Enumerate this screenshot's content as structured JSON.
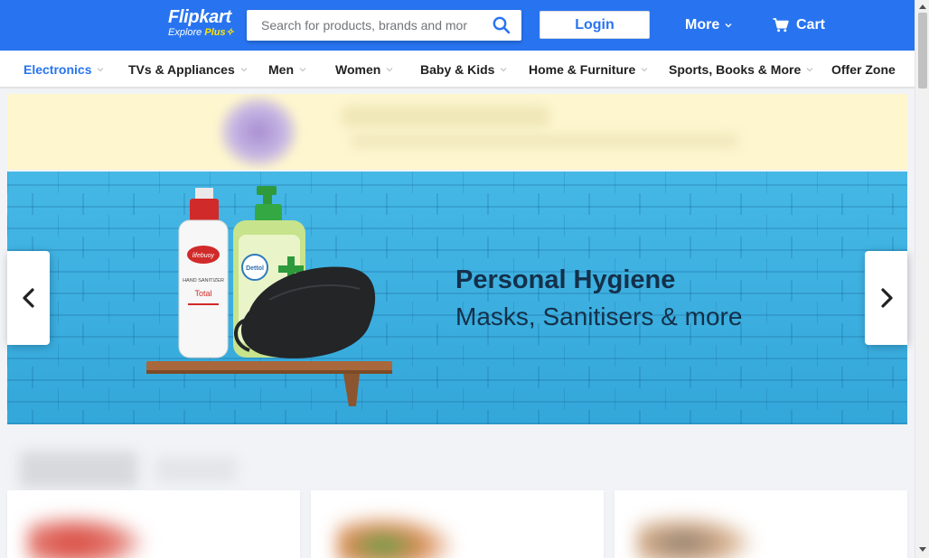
{
  "header": {
    "logo_text": "Flipkart",
    "logo_sub_explore": "Explore",
    "logo_sub_plus": "Plus",
    "search_placeholder": "Search for products, brands and more",
    "login_label": "Login",
    "more_label": "More",
    "cart_label": "Cart",
    "search_icon": "search-icon",
    "cart_icon": "cart-icon"
  },
  "categories": [
    {
      "label": "Electronics",
      "has_dropdown": true,
      "active": true
    },
    {
      "label": "TVs & Appliances",
      "has_dropdown": true
    },
    {
      "label": "Men",
      "has_dropdown": true
    },
    {
      "label": "Women",
      "has_dropdown": true
    },
    {
      "label": "Baby & Kids",
      "has_dropdown": true
    },
    {
      "label": "Home & Furniture",
      "has_dropdown": true
    },
    {
      "label": "Sports, Books & More",
      "has_dropdown": true
    },
    {
      "label": "Offer Zone",
      "has_dropdown": false
    }
  ],
  "banner": {
    "title": "Personal Hygiene",
    "subtitle": "Masks, Sanitisers & more",
    "product_labels": [
      "lifebuoy",
      "HAND SANITIZER",
      "Total",
      "Dettol"
    ],
    "prev_icon": "chevron-left-icon",
    "next_icon": "chevron-right-icon"
  },
  "colors": {
    "brand_blue": "#2874f0",
    "accent_yellow": "#ffe500",
    "banner_sky": "#3fb3e3"
  }
}
